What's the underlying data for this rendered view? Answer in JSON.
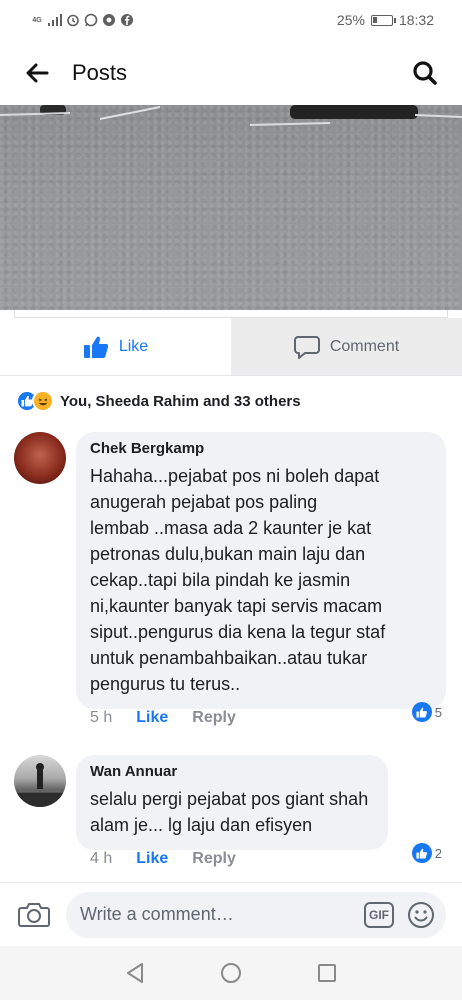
{
  "status_bar": {
    "network": "4G",
    "battery_percent": "25%",
    "battery_level": 0.25,
    "time": "18:32"
  },
  "header": {
    "title": "Posts"
  },
  "actions": {
    "like_label": "Like",
    "comment_label": "Comment"
  },
  "reactions": {
    "summary": "You, Sheeda Rahim and 33 others"
  },
  "comments": [
    {
      "author": "Chek Bergkamp",
      "text": "Hahaha...pejabat pos ni boleh dapat\nanugerah pejabat pos paling\nlembab ..masa ada 2 kaunter je kat\npetronas dulu,bukan main laju dan\ncekap..tapi bila pindah ke jasmin\nni,kaunter banyak tapi servis macam\nsiput..pengurus dia kena la tegur staf\nuntuk penambahbaikan..atau tukar\npengurus tu terus..",
      "time": "5 h",
      "like_label": "Like",
      "reply_label": "Reply",
      "like_count": "5"
    },
    {
      "author": "Wan Annuar",
      "text": "selalu pergi pejabat pos giant shah\nalam je... lg laju dan efisyen",
      "time": "4 h",
      "like_label": "Like",
      "reply_label": "Reply",
      "like_count": "2"
    }
  ],
  "composer": {
    "placeholder": "Write a comment…",
    "gif_label": "GIF"
  },
  "colors": {
    "accent": "#1877f2",
    "bubble": "#f0f2f5",
    "muted": "#8a8d91"
  },
  "icons": [
    "back-arrow-icon",
    "search-icon",
    "thumbs-up-icon",
    "comment-icon",
    "camera-icon",
    "gif-icon",
    "smiley-icon",
    "back-triangle-icon",
    "home-circle-icon",
    "recents-square-icon"
  ]
}
